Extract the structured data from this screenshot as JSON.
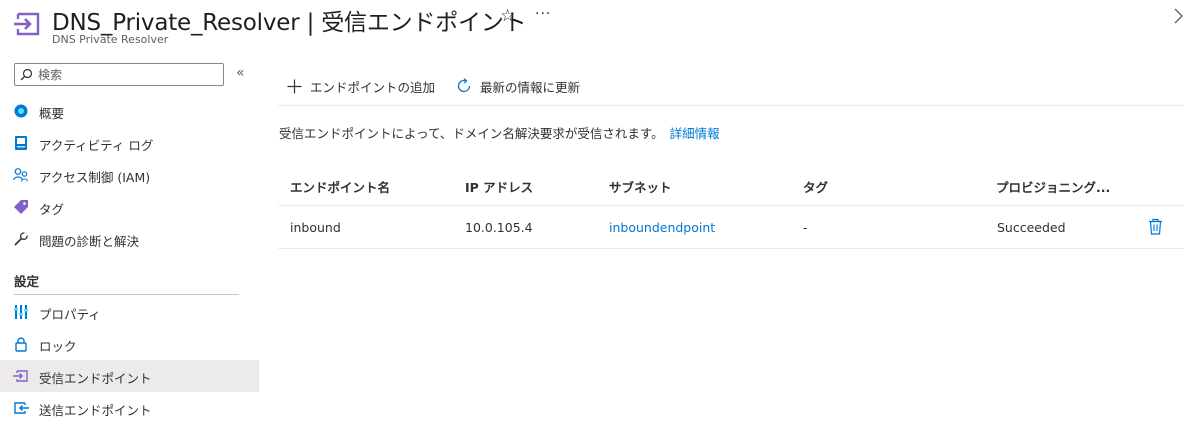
{
  "header": {
    "title": "DNS_Private_Resolver | 受信エンドポイント",
    "subtitle": "DNS Private Resolver",
    "favorite_icon": "star-icon",
    "more_label": "···"
  },
  "sidebar": {
    "search_placeholder": "検索",
    "collapse_label": "«",
    "items": [
      {
        "label": "概要",
        "icon": "overview-icon"
      },
      {
        "label": "アクティビティ ログ",
        "icon": "activity-log-icon"
      },
      {
        "label": "アクセス制御 (IAM)",
        "icon": "access-control-icon"
      },
      {
        "label": "タグ",
        "icon": "tag-icon"
      },
      {
        "label": "問題の診断と解決",
        "icon": "wrench-icon"
      }
    ],
    "section_label": "設定",
    "settings_items": [
      {
        "label": "プロパティ",
        "icon": "properties-icon"
      },
      {
        "label": "ロック",
        "icon": "lock-icon"
      },
      {
        "label": "受信エンドポイント",
        "icon": "inbound-endpoint-icon",
        "active": true
      },
      {
        "label": "送信エンドポイント",
        "icon": "outbound-endpoint-icon"
      }
    ]
  },
  "toolbar": {
    "add_label": "エンドポイントの追加",
    "refresh_label": "最新の情報に更新"
  },
  "description": {
    "text": "受信エンドポイントによって、ドメイン名解決要求が受信されます。",
    "link": "詳細情報"
  },
  "table": {
    "columns": [
      "エンドポイント名",
      "IP アドレス",
      "サブネット",
      "タグ",
      "プロビジョニング..."
    ],
    "rows": [
      {
        "name": "inbound",
        "ip": "10.0.105.4",
        "subnet": "inboundendpoint",
        "tags": "-",
        "state": "Succeeded"
      }
    ]
  },
  "colors": {
    "accent": "#0078d4",
    "endpoint_purple": "#8661c5",
    "active_bg": "#edebe9"
  }
}
